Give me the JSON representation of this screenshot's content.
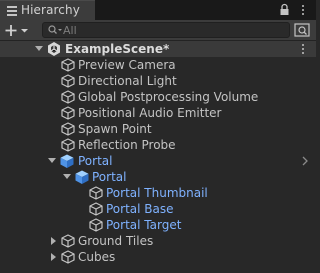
{
  "window": {
    "tab_title": "Hierarchy"
  },
  "toolbar": {
    "search_placeholder": "All"
  },
  "scene": {
    "name": "ExampleScene*"
  },
  "items": [
    {
      "label": "Preview Camera"
    },
    {
      "label": "Directional Light"
    },
    {
      "label": "Global Postprocessing Volume"
    },
    {
      "label": "Positional Audio Emitter"
    },
    {
      "label": "Spawn Point"
    },
    {
      "label": "Reflection Probe"
    },
    {
      "label": "Portal"
    },
    {
      "label": "Portal"
    },
    {
      "label": "Portal Thumbnail"
    },
    {
      "label": "Portal Base"
    },
    {
      "label": "Portal Target"
    },
    {
      "label": "Ground Tiles"
    },
    {
      "label": "Cubes"
    }
  ],
  "colors": {
    "background": "#282828",
    "toolbar": "#3c3c3c",
    "text": "#c4c4c4",
    "prefab_blue": "#7fb2ff"
  }
}
